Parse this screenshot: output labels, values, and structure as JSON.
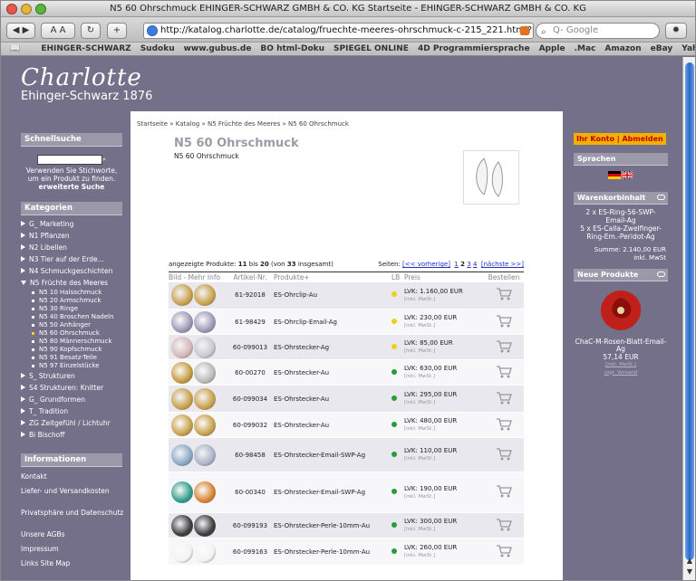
{
  "window": {
    "title": "N5 60 Ohrschmuck EHINGER-SCHWARZ GMBH & CO. KG Startseite - EHINGER-SCHWARZ GMBH & CO. KG",
    "url": "http://katalog.charlotte.de/catalog/fruechte-meeres-ohrschmuck-c-215_221.html?pag",
    "search_placeholder": "Q- Google"
  },
  "bookmarks": [
    "EHINGER-SCHWARZ",
    "Sudoku",
    "www.gubus.de",
    "BO html-Doku",
    "SPIEGEL ONLINE",
    "4D Programmiersprache",
    "Apple",
    ".Mac",
    "Amazon",
    "eBay",
    "Yahoo!",
    "News ▾"
  ],
  "logo": {
    "name": "Charlotte",
    "sub": "Ehinger-Schwarz 1876"
  },
  "left": {
    "quicksearch_title": "Schnellsuche",
    "quicksearch_hint": "Verwenden Sie Stichworte, um ein Produkt zu finden.",
    "quicksearch_adv": "erweiterte Suche",
    "categories_title": "Kategorien",
    "categories": [
      {
        "label": "G_ Marketing",
        "level": 0
      },
      {
        "label": "N1 Pflanzen",
        "level": 0
      },
      {
        "label": "N2 Libellen",
        "level": 0
      },
      {
        "label": "N3 Tier auf der Erde...",
        "level": 0
      },
      {
        "label": "N4 Schmuckgeschichten",
        "level": 0
      },
      {
        "label": "N5 Früchte des Meeres",
        "level": 0,
        "open": true
      },
      {
        "label": "N5 10 Halsschmuck",
        "level": 1
      },
      {
        "label": "N5 20 Armschmuck",
        "level": 1
      },
      {
        "label": "N5 30 Ringe",
        "level": 1
      },
      {
        "label": "N5 40 Broschen Nadeln",
        "level": 1
      },
      {
        "label": "N5 50 Anhänger",
        "level": 1
      },
      {
        "label": "N5 60 Ohrschmuck",
        "level": 1,
        "active": true
      },
      {
        "label": "N5 80 Männerschmuck",
        "level": 1
      },
      {
        "label": "N5 90 Kopfschmuck",
        "level": 1
      },
      {
        "label": "N5 91 Besatz-Teile",
        "level": 1
      },
      {
        "label": "N5 97 Einzelstücke",
        "level": 1
      },
      {
        "label": "S_ Strukturen",
        "level": 0
      },
      {
        "label": "S4 Strukturen: Knitter",
        "level": 0
      },
      {
        "label": "G_ Grundformen",
        "level": 0
      },
      {
        "label": "T_ Tradition",
        "level": 0
      },
      {
        "label": "ZG Zeitgefühl / Lichtuhr",
        "level": 0
      },
      {
        "label": "Bi Bischoff",
        "level": 0
      }
    ],
    "info_title": "Informationen",
    "info": [
      "Kontakt",
      "Liefer- und Versandkosten",
      "Privatsphäre und Datenschutz",
      "Unsere AGBs",
      "Impressum",
      "Links Site Map"
    ]
  },
  "main": {
    "breadcrumb": "Startseite » Katalog » N5 Früchte des Meeres » N5 60 Ohrschmuck",
    "title": "N5 60 Ohrschmuck",
    "subtitle": "N5 60 Ohrschmuck",
    "pager_left_pre": "angezeigte Produkte: ",
    "pager_from": "11",
    "pager_mid": " bis ",
    "pager_to": "20",
    "pager_post_pre": " (von ",
    "pager_total": "33",
    "pager_post": " insgesamt)",
    "pages_label": "Seiten: ",
    "prev": "[<< vorherige]",
    "pages": [
      "1",
      "2",
      "3",
      "4"
    ],
    "next": "[nächste >>]",
    "headers": [
      "Bild - Mehr Info",
      "Artikel-Nr.",
      "Produkte+",
      "LB",
      "Preis",
      "Bestellen"
    ],
    "rows": [
      {
        "nr": "61-92018",
        "name": "ES-Ohrclip-Au",
        "status": "#e8d21a",
        "price": "LVK: 1.160,00 EUR",
        "tax": "[inkl. MwSt.]",
        "c1": "#c8a14b",
        "c2": "#c8a14b"
      },
      {
        "nr": "61-98429",
        "name": "ES-Ohrclip-Email-Ag",
        "status": "#e8d21a",
        "price": "LVK: 230,00 EUR",
        "tax": "[inkl. MwSt.]",
        "c1": "#9e96b5",
        "c2": "#9e96b5"
      },
      {
        "nr": "60-099013",
        "name": "ES-Ohrstecker-Ag",
        "status": "#e8d21a",
        "price": "LVK: 85,00 EUR",
        "tax": "[inkl. MwSt.]",
        "c1": "#d4b7b8",
        "c2": "#c7c7d2"
      },
      {
        "nr": "60-00270",
        "name": "ES-Ohrstecker-Au",
        "status": "#2b9a3a",
        "price": "LVK: 630,00 EUR",
        "tax": "[inkl. MwSt.]",
        "c1": "#c59a3c",
        "c2": "#b9b9b9"
      },
      {
        "nr": "60-099034",
        "name": "ES-Ohrstecker-Au",
        "status": "#2b9a3a",
        "price": "LVK: 295,00 EUR",
        "tax": "[inkl. MwSt.]",
        "c1": "#c9a04a",
        "c2": "#c9a04a"
      },
      {
        "nr": "60-099032",
        "name": "ES-Ohrstecker-Au",
        "status": "#2b9a3a",
        "price": "LVK: 480,00 EUR",
        "tax": "[inkl. MwSt.]",
        "c1": "#c8a04a",
        "c2": "#c8a04a"
      },
      {
        "nr": "60-98458",
        "name": "ES-Ohrstecker-Email-SWP-Ag",
        "status": "#2b9a3a",
        "price": "LVK: 110,00 EUR",
        "tax": "[inkl. MwSt.]",
        "c1": "#8aa7c5",
        "c2": "#aab2c5"
      },
      {
        "nr": "60-00340",
        "name": "ES-Ohrstecker-Email-SWP-Ag",
        "status": "#2b9a3a",
        "price": "LVK: 190,00 EUR",
        "tax": "[inkl. MwSt.]",
        "c1": "#2f9c8c",
        "c2": "#d7822e"
      },
      {
        "nr": "60-099193",
        "name": "ES-Ohrstecker-Perle-10mm-Au",
        "status": "#2b9a3a",
        "price": "LVK: 300,00 EUR",
        "tax": "[inkl. MwSt.]",
        "c1": "#3a3a3a",
        "c2": "#3a3a3a"
      },
      {
        "nr": "60-099163",
        "name": "ES-Ohrstecker-Perle-10mm-Au",
        "status": "#2b9a3a",
        "price": "LVK: 260,00 EUR",
        "tax": "[inkl. MwSt.]",
        "c1": "#f3f3f3",
        "c2": "#f3f3f3"
      }
    ]
  },
  "right": {
    "account": "Ihr Konto",
    "logout": "Abmelden",
    "lang_title": "Sprachen",
    "cart_title": "Warenkorbinhalt",
    "cart_items": [
      "2 x ES-Ring-56-SWP-Email-Ag",
      "5 x ES-Calla-Zwelfinger-Ring-Em.-Peridot-Ag"
    ],
    "cart_sum": "Summe: 2.140,00 EUR",
    "cart_sum_tax": "inkl. MwSt",
    "new_title": "Neue Produkte",
    "new_name": "ChaC-M-Rosen-Blatt-Email-Ag",
    "new_price": "57,14 EUR",
    "new_tax": "[inkl. MwSt.]",
    "new_extra": "zzgl. Versand"
  }
}
